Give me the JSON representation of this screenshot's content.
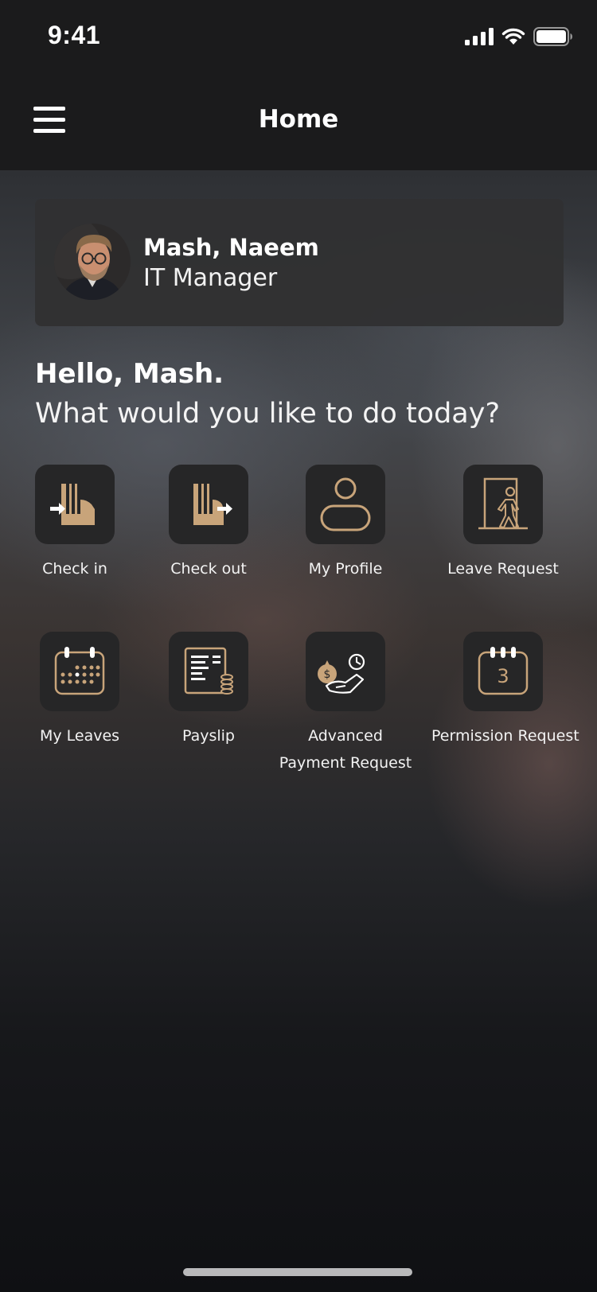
{
  "status_bar": {
    "time": "9:41",
    "icons": [
      "signal-icon",
      "wifi-icon",
      "battery-icon"
    ]
  },
  "nav": {
    "title": "Home",
    "menu_icon": "hamburger-menu-icon"
  },
  "profile": {
    "name": "Mash, Naeem",
    "role": "IT Manager",
    "avatar": "user-avatar-photo"
  },
  "greeting": {
    "hello": "Hello, Mash.",
    "prompt": "What would you like to do today?"
  },
  "actions": [
    {
      "label": "Check in",
      "icon": "check-in-icon"
    },
    {
      "label": "Check out",
      "icon": "check-out-icon"
    },
    {
      "label": "My Profile",
      "icon": "profile-icon"
    },
    {
      "label": "Leave Request",
      "icon": "leave-request-icon"
    },
    {
      "label": "My Leaves",
      "icon": "calendar-icon"
    },
    {
      "label": "Payslip",
      "icon": "payslip-icon"
    },
    {
      "label": "Advanced Payment Request",
      "icon": "advance-payment-icon"
    },
    {
      "label": "Permission Request",
      "icon": "permission-calendar-icon",
      "badge": "3"
    }
  ],
  "colors": {
    "accent": "#c8a47a",
    "background": "#1b1b1c",
    "card": "#303032",
    "tile": "#262627"
  }
}
